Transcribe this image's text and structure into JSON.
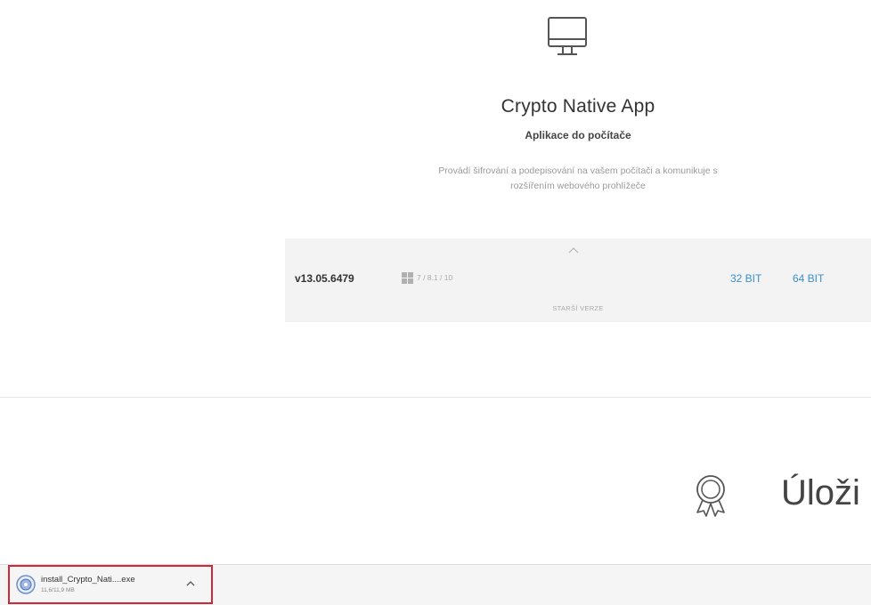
{
  "app": {
    "icon": "monitor-icon",
    "title": "Crypto Native App",
    "subtitle": "Aplikace do počítače",
    "description": "Provádí šifrování a podepisování na vašem počítači a komunikuje s rozšířením webového prohlížeče",
    "version": "v13.05.6479",
    "os_icon": "windows-icon",
    "os_list": "7 / 8.1 / 10",
    "download_32": "32 BIT",
    "download_64": "64 BIT",
    "older_versions": "STARŠÍ VERZE"
  },
  "section": {
    "icon": "award-icon",
    "title": "Úloži"
  },
  "download_bar": {
    "file_name": "install_Crypto_Nati....exe",
    "status": "11,6/11,9 MB"
  },
  "colors": {
    "link": "#3b8fd1",
    "highlight_border": "#cc2a3b",
    "panel_bg": "#f3f3f3"
  }
}
